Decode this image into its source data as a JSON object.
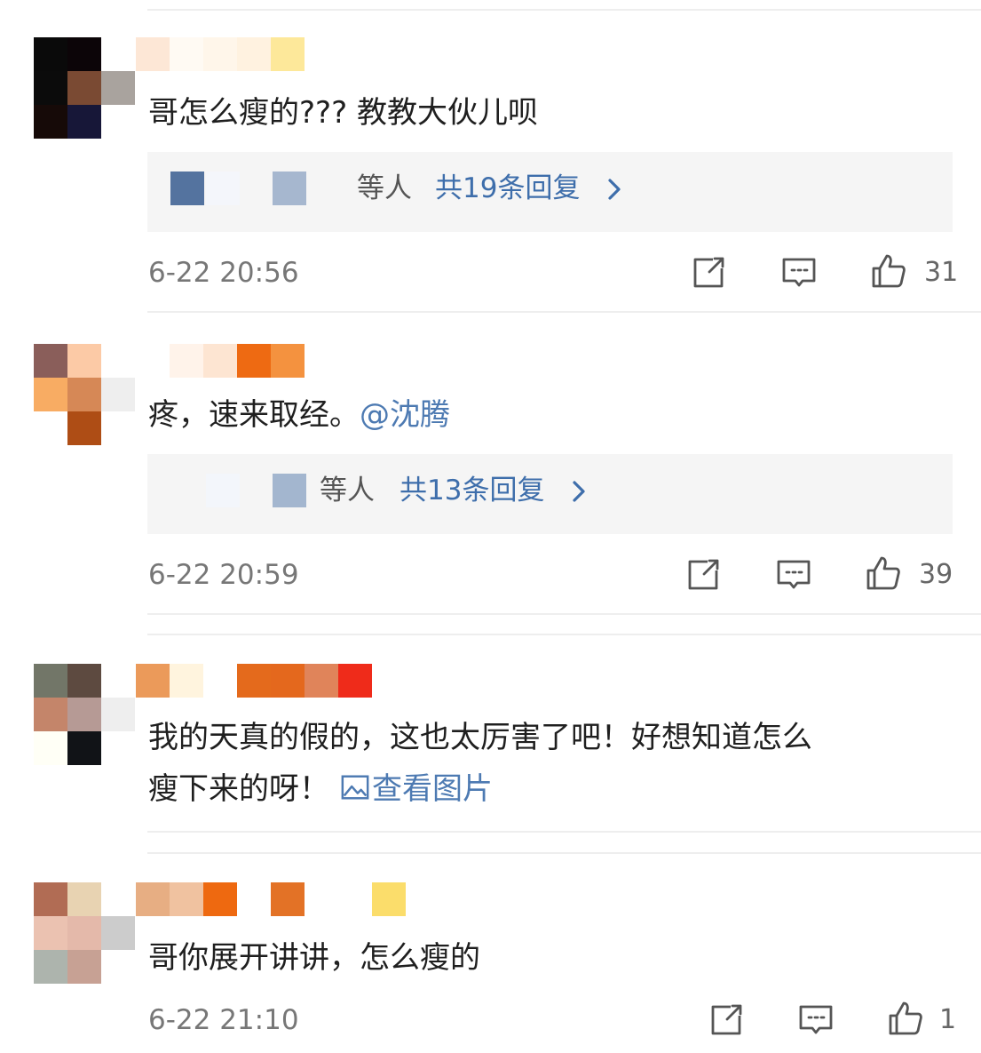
{
  "comments": [
    {
      "avatar_colors": [
        "#0a0a0a",
        "#0c0508",
        "#ffffff",
        "#0b0b0b",
        "#7a4a33",
        "#a9a39e",
        "#160a08",
        "#171738",
        "#ffffff"
      ],
      "nick_colors": [
        "#fde7d6",
        "#fffaf3",
        "#fff6ea",
        "#fff2e0",
        "#fde89a",
        "#ffffff",
        "#ffffff"
      ],
      "text": "哥怎么瘦的??? 教教大伙儿呗",
      "replies": {
        "avatars": [
          "#54739f",
          "#f4f6fb",
          "#a6b7cf"
        ],
        "others_label": "等人",
        "count_label": "共19条回复"
      },
      "time": "6-22 20:56",
      "likes": "31"
    },
    {
      "avatar_colors": [
        "#8a5e5a",
        "#fccaa6",
        "#ffffff",
        "#f8ac63",
        "#d68856",
        "#eeeeee",
        "#ffffff",
        "#ae4d15",
        "#ffffff"
      ],
      "nick_colors": [
        "#ffffff",
        "#fff3ea",
        "#fde5d2",
        "#ee6a12",
        "#f4923f",
        "#ffffff",
        "#ffffff"
      ],
      "text_prefix": "疼，速来取经。",
      "mention": "@沈腾",
      "replies": {
        "avatars": [
          "#f3f6fb",
          "#a3b6cf"
        ],
        "others_label": "等人",
        "count_label": "共13条回复"
      },
      "time": "6-22 20:59",
      "likes": "39"
    },
    {
      "avatar_colors": [
        "#727668",
        "#5d4a40",
        "#ffffff",
        "#c4856a",
        "#b69a95",
        "#eeeeee",
        "#fffff6",
        "#111317",
        "#ffffff"
      ],
      "nick_colors": [
        "#eb9a5a",
        "#fff4de",
        "#ffffff",
        "#e46a1c",
        "#e4681d",
        "#e0845a",
        "#ef2b1a"
      ],
      "text_line1": "我的天真的假的，这也太厉害了吧！好想知道怎么",
      "text_line2": "瘦下来的呀！",
      "image_link": "查看图片"
    },
    {
      "avatar_colors": [
        "#b16c54",
        "#e8d3b2",
        "#ffffff",
        "#ebc2b1",
        "#e4b9aa",
        "#cccccc",
        "#adb4ad",
        "#c7a194",
        "#ffffff"
      ],
      "nick_colors": [
        "#e7ae83",
        "#f0c2a0",
        "#ee6910",
        "#ffffff",
        "#e37226",
        "#ffffff",
        "#ffffff",
        "#fbdd6b"
      ],
      "text": "哥你展开讲讲，怎么瘦的",
      "time": "6-22 21:10",
      "likes": "1"
    }
  ],
  "icons": {
    "repost": "repost-icon",
    "comment": "comment-icon",
    "like": "thumbs-up-icon",
    "chevron": "chevron-right-icon",
    "image": "image-icon"
  },
  "colors": {
    "link": "#4d7ab2",
    "reply_count": "#3e6eab",
    "meta_gray": "#777777",
    "reply_bg": "#f5f5f5"
  }
}
